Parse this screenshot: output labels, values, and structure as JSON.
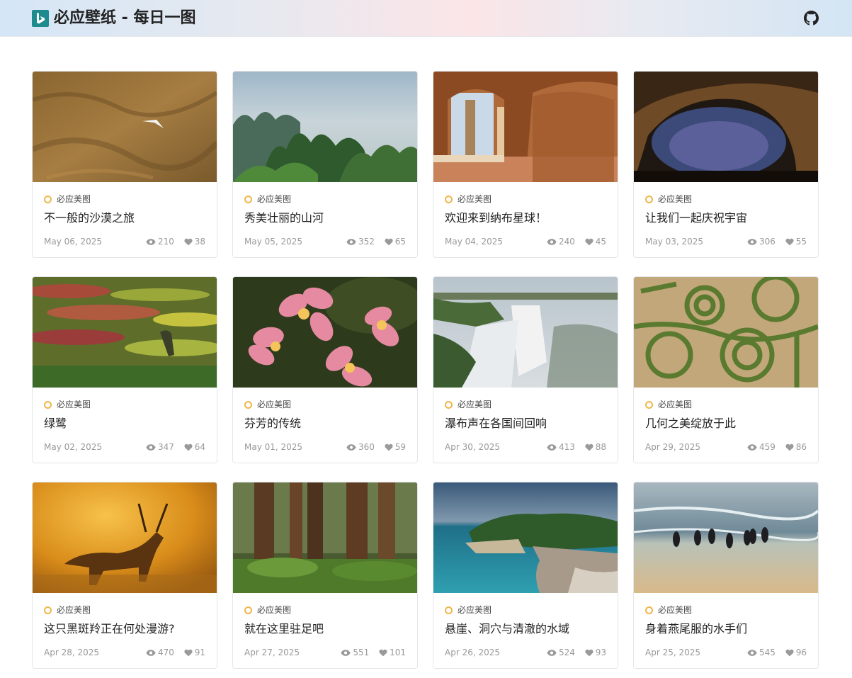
{
  "site": {
    "title": "必应壁纸 - 每日一图"
  },
  "cards": [
    {
      "tag": "必应美图",
      "title": "不一般的沙漠之旅",
      "date": "May 06, 2025",
      "views": "210",
      "likes": "38"
    },
    {
      "tag": "必应美图",
      "title": "秀美壮丽的山河",
      "date": "May 05, 2025",
      "views": "352",
      "likes": "65"
    },
    {
      "tag": "必应美图",
      "title": "欢迎来到纳布星球！",
      "date": "May 04, 2025",
      "views": "240",
      "likes": "45"
    },
    {
      "tag": "必应美图",
      "title": "让我们一起庆祝宇宙",
      "date": "May 03, 2025",
      "views": "306",
      "likes": "55"
    },
    {
      "tag": "必应美图",
      "title": "绿鹭",
      "date": "May 02, 2025",
      "views": "347",
      "likes": "64"
    },
    {
      "tag": "必应美图",
      "title": "芬芳的传统",
      "date": "May 01, 2025",
      "views": "360",
      "likes": "59"
    },
    {
      "tag": "必应美图",
      "title": "瀑布声在各国间回响",
      "date": "Apr 30, 2025",
      "views": "413",
      "likes": "88"
    },
    {
      "tag": "必应美图",
      "title": "几何之美绽放于此",
      "date": "Apr 29, 2025",
      "views": "459",
      "likes": "86"
    },
    {
      "tag": "必应美图",
      "title": "这只黑斑羚正在何处漫游?",
      "date": "Apr 28, 2025",
      "views": "470",
      "likes": "91"
    },
    {
      "tag": "必应美图",
      "title": "就在这里驻足吧",
      "date": "Apr 27, 2025",
      "views": "551",
      "likes": "101"
    },
    {
      "tag": "必应美图",
      "title": "悬崖、洞穴与清澈的水域",
      "date": "Apr 26, 2025",
      "views": "524",
      "likes": "93"
    },
    {
      "tag": "必应美图",
      "title": "身着燕尾服的水手们",
      "date": "Apr 25, 2025",
      "views": "545",
      "likes": "96"
    }
  ]
}
